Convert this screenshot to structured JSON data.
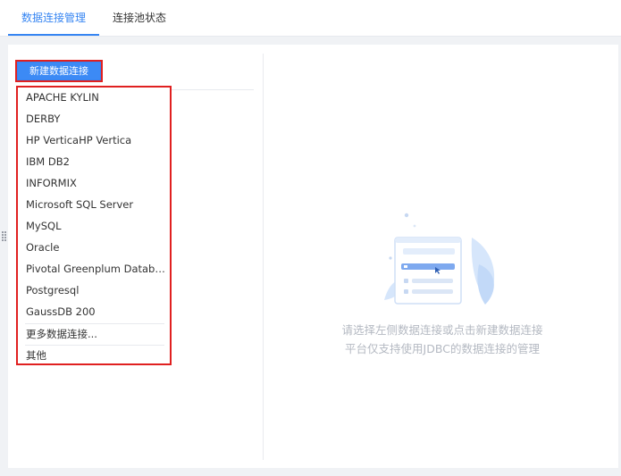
{
  "tabs": [
    {
      "label": "数据连接管理",
      "active": true
    },
    {
      "label": "连接池状态",
      "active": false
    }
  ],
  "new_button": {
    "label": "新建数据连接"
  },
  "dropdown": {
    "items": [
      "APACHE KYLIN",
      "DERBY",
      "HP VerticaHP Vertica",
      "IBM DB2",
      "INFORMIX",
      "Microsoft SQL Server",
      "MySQL",
      "Oracle",
      "Pivotal Greenplum Databa...",
      "Postgresql",
      "GaussDB 200"
    ],
    "more": "更多数据连接...",
    "other": "其他"
  },
  "empty_state": {
    "line1": "请选择左侧数据连接或点击新建数据连接",
    "line2": "平台仅支持使用JDBC的数据连接的管理",
    "icon": "document-list-illustration"
  },
  "colors": {
    "accent": "#3685f2",
    "highlight_border": "#e02020",
    "muted_text": "#b4b9c2"
  }
}
